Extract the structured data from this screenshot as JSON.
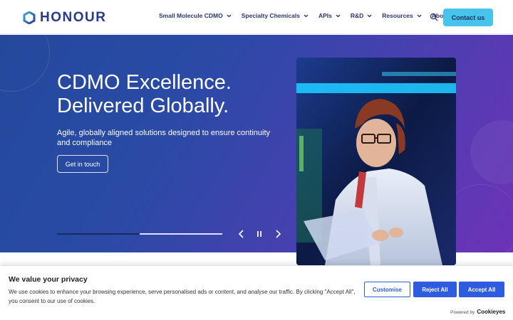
{
  "header": {
    "logo_text": "HONOUR",
    "nav": [
      {
        "label": "Small Molecule CDMO"
      },
      {
        "label": "Specialty Chemicals"
      },
      {
        "label": "APIs"
      },
      {
        "label": "R&D"
      },
      {
        "label": "Resources"
      },
      {
        "label": "About Us"
      }
    ],
    "contact_label": "Contact us",
    "search_icon": "search-icon"
  },
  "hero": {
    "title_line1": "CDMO Excellence.",
    "title_line2": "Delivered Globally.",
    "subtitle": "Agile, globally aligned solutions designed to ensure continuity and compliance",
    "cta_label": "Get in touch",
    "slide_progress": 0.5,
    "controls": [
      "chevron-left-icon",
      "pause-icon",
      "chevron-right-icon"
    ]
  },
  "colors": {
    "brand": "#2a3a8a",
    "accent": "#48c4ec",
    "cookie_button": "#2e5ce0",
    "hero_gradient_start": "#24499c",
    "hero_gradient_end": "#6d33b8"
  },
  "cookie": {
    "title": "We value your privacy",
    "text": "We use cookies to enhance your browsing experience, serve personalised ads or content, and analyse our traffic. By clicking \"Accept All\", you consent to our use of cookies.",
    "customise_label": "Customise",
    "reject_label": "Reject All",
    "accept_label": "Accept All",
    "powered_by": "Powered by",
    "powered_brand": "Cookieyes"
  }
}
